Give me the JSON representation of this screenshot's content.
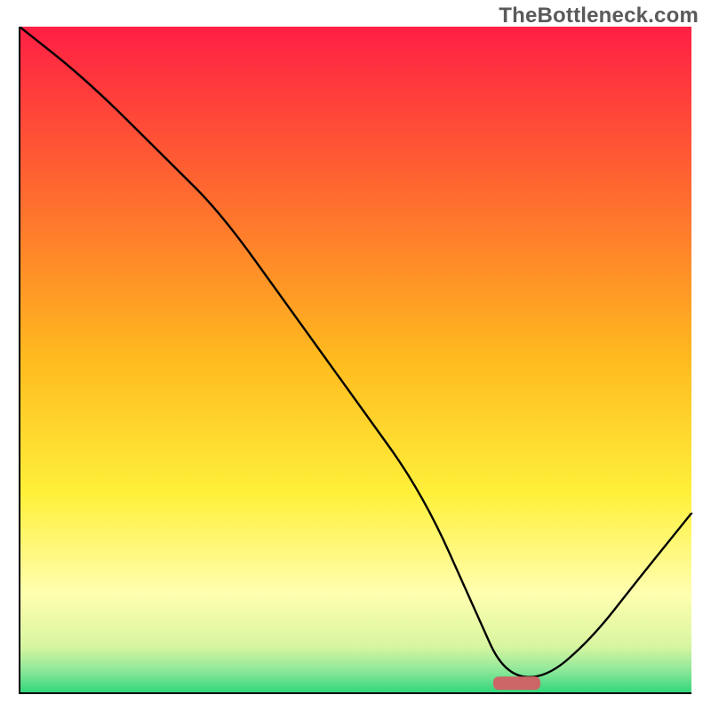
{
  "watermark": "TheBottleneck.com",
  "chart_data": {
    "type": "line",
    "title": "",
    "xlabel": "",
    "ylabel": "",
    "xlim": [
      0,
      100
    ],
    "ylim": [
      0,
      100
    ],
    "grid": false,
    "legend": false,
    "background_gradient": {
      "stops": [
        {
          "offset": 0.0,
          "color": "#ff1f44"
        },
        {
          "offset": 0.25,
          "color": "#ff6a2f"
        },
        {
          "offset": 0.5,
          "color": "#ffbb1f"
        },
        {
          "offset": 0.7,
          "color": "#fff03a"
        },
        {
          "offset": 0.85,
          "color": "#ffffb0"
        },
        {
          "offset": 0.93,
          "color": "#d8f5a0"
        },
        {
          "offset": 0.965,
          "color": "#8fe89a"
        },
        {
          "offset": 1.0,
          "color": "#2fd67a"
        }
      ]
    },
    "series": [
      {
        "name": "bottleneck-curve",
        "x": [
          0,
          10,
          22,
          30,
          40,
          50,
          60,
          68,
          72,
          78,
          85,
          92,
          100
        ],
        "y": [
          100,
          92,
          80,
          72,
          58,
          44,
          30,
          12,
          3,
          2,
          8,
          17,
          27
        ]
      }
    ],
    "marker": {
      "name": "optimal-range",
      "x_center": 74,
      "y": 1.5,
      "width": 7,
      "height": 2
    }
  }
}
